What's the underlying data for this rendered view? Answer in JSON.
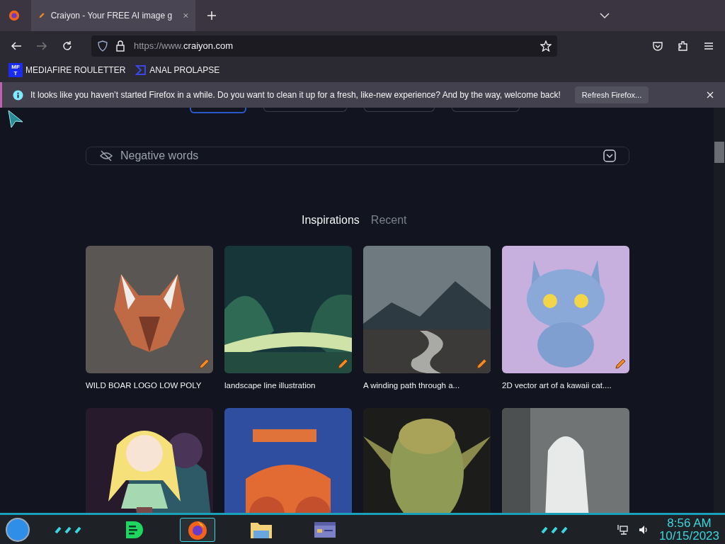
{
  "browser": {
    "tabs": [
      {
        "title": "Craiyon - Your FREE AI image g",
        "selected": true
      }
    ],
    "url": {
      "prefix": "https://www.",
      "domain": "craiyon.com"
    },
    "bookmarks": [
      {
        "label": "MEDIAFIRE ROULETTER",
        "kind": "mf",
        "icon_lines": [
          "MF",
          "T"
        ]
      },
      {
        "label": "ANAL PROLAPSE",
        "kind": "sigma"
      }
    ]
  },
  "notification": {
    "text": "It looks like you haven’t started Firefox in a while. Do you want to clean it up for a fresh, like-new experience? And by the way, welcome back!",
    "button": "Refresh Firefox..."
  },
  "page": {
    "mode_tabs": [
      {
        "selected": true
      },
      {
        "selected": false
      },
      {
        "selected": false
      },
      {
        "selected": false
      }
    ],
    "negative_field": {
      "placeholder": "Negative words"
    },
    "gallery_tabs": [
      {
        "label": "Inspirations",
        "selected": true
      },
      {
        "label": "Recent",
        "selected": false
      }
    ],
    "cards": [
      {
        "caption": "WILD BOAR LOGO LOW POLY",
        "edit_badge": true
      },
      {
        "caption": "landscape line illustration",
        "edit_badge": true
      },
      {
        "caption": "A winding path through a...",
        "edit_badge": true
      },
      {
        "caption": "2D vector art of a kawaii cat....",
        "edit_badge": true
      },
      {
        "edit_badge": false
      },
      {
        "edit_badge": false
      },
      {
        "edit_badge": false
      },
      {
        "edit_badge": false
      }
    ]
  },
  "taskbar": {
    "apps": [
      {
        "kind": "chat",
        "selected": false
      },
      {
        "kind": "firefox",
        "selected": true
      },
      {
        "kind": "folder",
        "selected": false
      },
      {
        "kind": "window",
        "selected": false
      }
    ],
    "time": "8:56 AM",
    "date": "10/15/2023"
  }
}
